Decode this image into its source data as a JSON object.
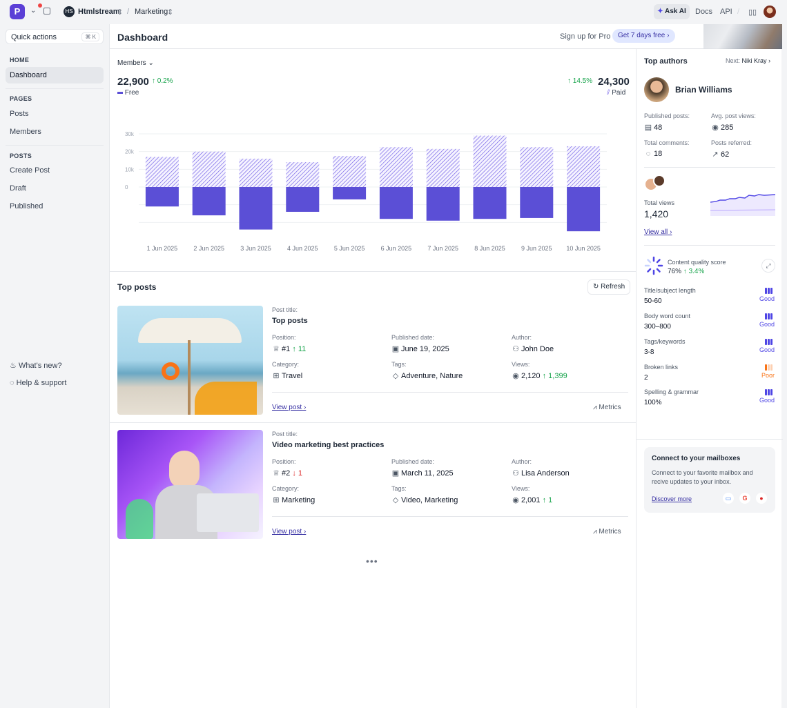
{
  "topbar": {
    "workspace": "Htmlstream",
    "workspace_initials": "HS",
    "section": "Marketing",
    "ask_ai": "Ask AI",
    "docs": "Docs",
    "api": "API"
  },
  "sidebar": {
    "quick_actions": "Quick actions",
    "shortcut": "⌘ K",
    "home_label": "HOME",
    "dashboard": "Dashboard",
    "pages_label": "PAGES",
    "posts": "Posts",
    "members": "Members",
    "posts_label": "POSTS",
    "create_post": "Create Post",
    "draft": "Draft",
    "published": "Published",
    "whats_new": "What's new?",
    "help": "Help & support"
  },
  "header": {
    "title": "Dashboard",
    "signup": "Sign up for Pro",
    "trial": "Get 7 days free"
  },
  "members": {
    "dropdown": "Members",
    "free_value": "22,900",
    "free_change": "0.2%",
    "free_label": "Free",
    "paid_value": "24,300",
    "paid_change": "14.5%",
    "paid_label": "Paid"
  },
  "chart_data": {
    "type": "bar",
    "categories": [
      "1 Jun 2025",
      "2 Jun 2025",
      "3 Jun 2025",
      "4 Jun 2025",
      "5 Jun 2025",
      "6 Jun 2025",
      "7 Jun 2025",
      "8 Jun 2025",
      "9 Jun 2025",
      "10 Jun 2025"
    ],
    "series": [
      {
        "name": "Paid",
        "values": [
          17000,
          20000,
          16000,
          14000,
          17500,
          22500,
          21500,
          29000,
          22500,
          23000
        ],
        "color": "#6d5ae6",
        "pattern": "hatched"
      },
      {
        "name": "Free",
        "values": [
          -11000,
          -16000,
          -24000,
          -14000,
          -7000,
          -18000,
          -19000,
          -18000,
          -17500,
          -25000
        ],
        "color": "#5b4fd6"
      }
    ],
    "yticks": [
      "30k",
      "20k",
      "10k",
      "0"
    ],
    "ytick_values": [
      30000,
      20000,
      10000,
      0
    ],
    "ylim": [
      -26000,
      31000
    ],
    "grid": true
  },
  "top_posts": {
    "title": "Top posts",
    "refresh": "Refresh",
    "labels": {
      "post_title": "Post title:",
      "position": "Position:",
      "published_date": "Published date:",
      "author": "Author:",
      "category": "Category:",
      "tags": "Tags:",
      "views": "Views:",
      "view_post": "View post",
      "metrics": "Metrics"
    },
    "posts": [
      {
        "title": "Top posts",
        "position": "#1",
        "position_change": "11",
        "date": "June 19, 2025",
        "author": "John Doe",
        "category": "Travel",
        "tags": "Adventure, Nature",
        "views": "2,120",
        "views_change": "1,399",
        "trend": "up"
      },
      {
        "title": "Video marketing best practices",
        "position": "#2",
        "position_change": "1",
        "date": "March 11, 2025",
        "author": "Lisa Anderson",
        "category": "Marketing",
        "tags": "Video, Marketing",
        "views": "2,001",
        "views_change": "1",
        "trend": "down"
      }
    ]
  },
  "right": {
    "top_authors": "Top authors",
    "next": "Next:",
    "next_name": "Niki Kray",
    "author_name": "Brian Williams",
    "published_posts_label": "Published posts:",
    "published_posts": "48",
    "avg_views_label": "Avg. post views:",
    "avg_views": "285",
    "comments_label": "Total comments:",
    "comments": "18",
    "referred_label": "Posts referred:",
    "referred": "62",
    "total_views_label": "Total views",
    "total_views": "1,420",
    "view_all": "View all",
    "quality_label": "Content quality score",
    "quality_score": "76%",
    "quality_change": "3.4%",
    "quality_rows": [
      {
        "label": "Title/subject length",
        "value": "50-60",
        "rating": "Good",
        "level": 3,
        "color": "#4f46e5"
      },
      {
        "label": "Body word count",
        "value": "300–800",
        "rating": "Good",
        "level": 3,
        "color": "#4f46e5"
      },
      {
        "label": "Tags/keywords",
        "value": "3-8",
        "rating": "Good",
        "level": 3,
        "color": "#4f46e5"
      },
      {
        "label": "Broken links",
        "value": "2",
        "rating": "Poor",
        "level": 1,
        "color": "#f97316"
      },
      {
        "label": "Spelling & grammar",
        "value": "100%",
        "rating": "Good",
        "level": 3,
        "color": "#4f46e5"
      }
    ],
    "mailbox_title": "Connect to your mailboxes",
    "mailbox_text": "Connect to your favorite mailbox and recive updates to your inbox.",
    "discover": "Discover more"
  }
}
